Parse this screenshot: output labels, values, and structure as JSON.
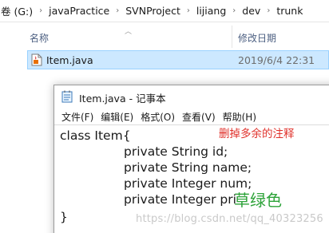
{
  "explorer": {
    "breadcrumbs": [
      "卷 (G:)",
      "javaPractice",
      "SVNProject",
      "lijiang",
      "dev",
      "trunk"
    ],
    "breadcrumb_separator": "›",
    "columns": {
      "name": "名称",
      "date_modified": "修改日期"
    },
    "files": [
      {
        "name": "Item.java",
        "date_modified": "2019/6/4 22:31",
        "icon": "java-file-icon",
        "selected": true
      }
    ]
  },
  "notepad": {
    "title": "Item.java - 记事本",
    "menus": [
      "文件(F)",
      "编辑(E)",
      "格式(O)",
      "查看(V)",
      "帮助(H)"
    ],
    "content_lines": [
      "class Item{",
      "private String id;",
      "private String name;",
      "private Integer num;",
      "private Integer pri",
      "}"
    ],
    "annotations": {
      "red_note": "删掉多余的注释",
      "red_color": "#e0302a",
      "green_note": "草绿色",
      "green_color": "#2ea33a"
    },
    "watermark": "https://blog.csdn.net/qq_40323256"
  },
  "colors": {
    "selection_bg": "#cce8ff",
    "selection_border": "#99d1ff",
    "header_text": "#4d6082"
  }
}
